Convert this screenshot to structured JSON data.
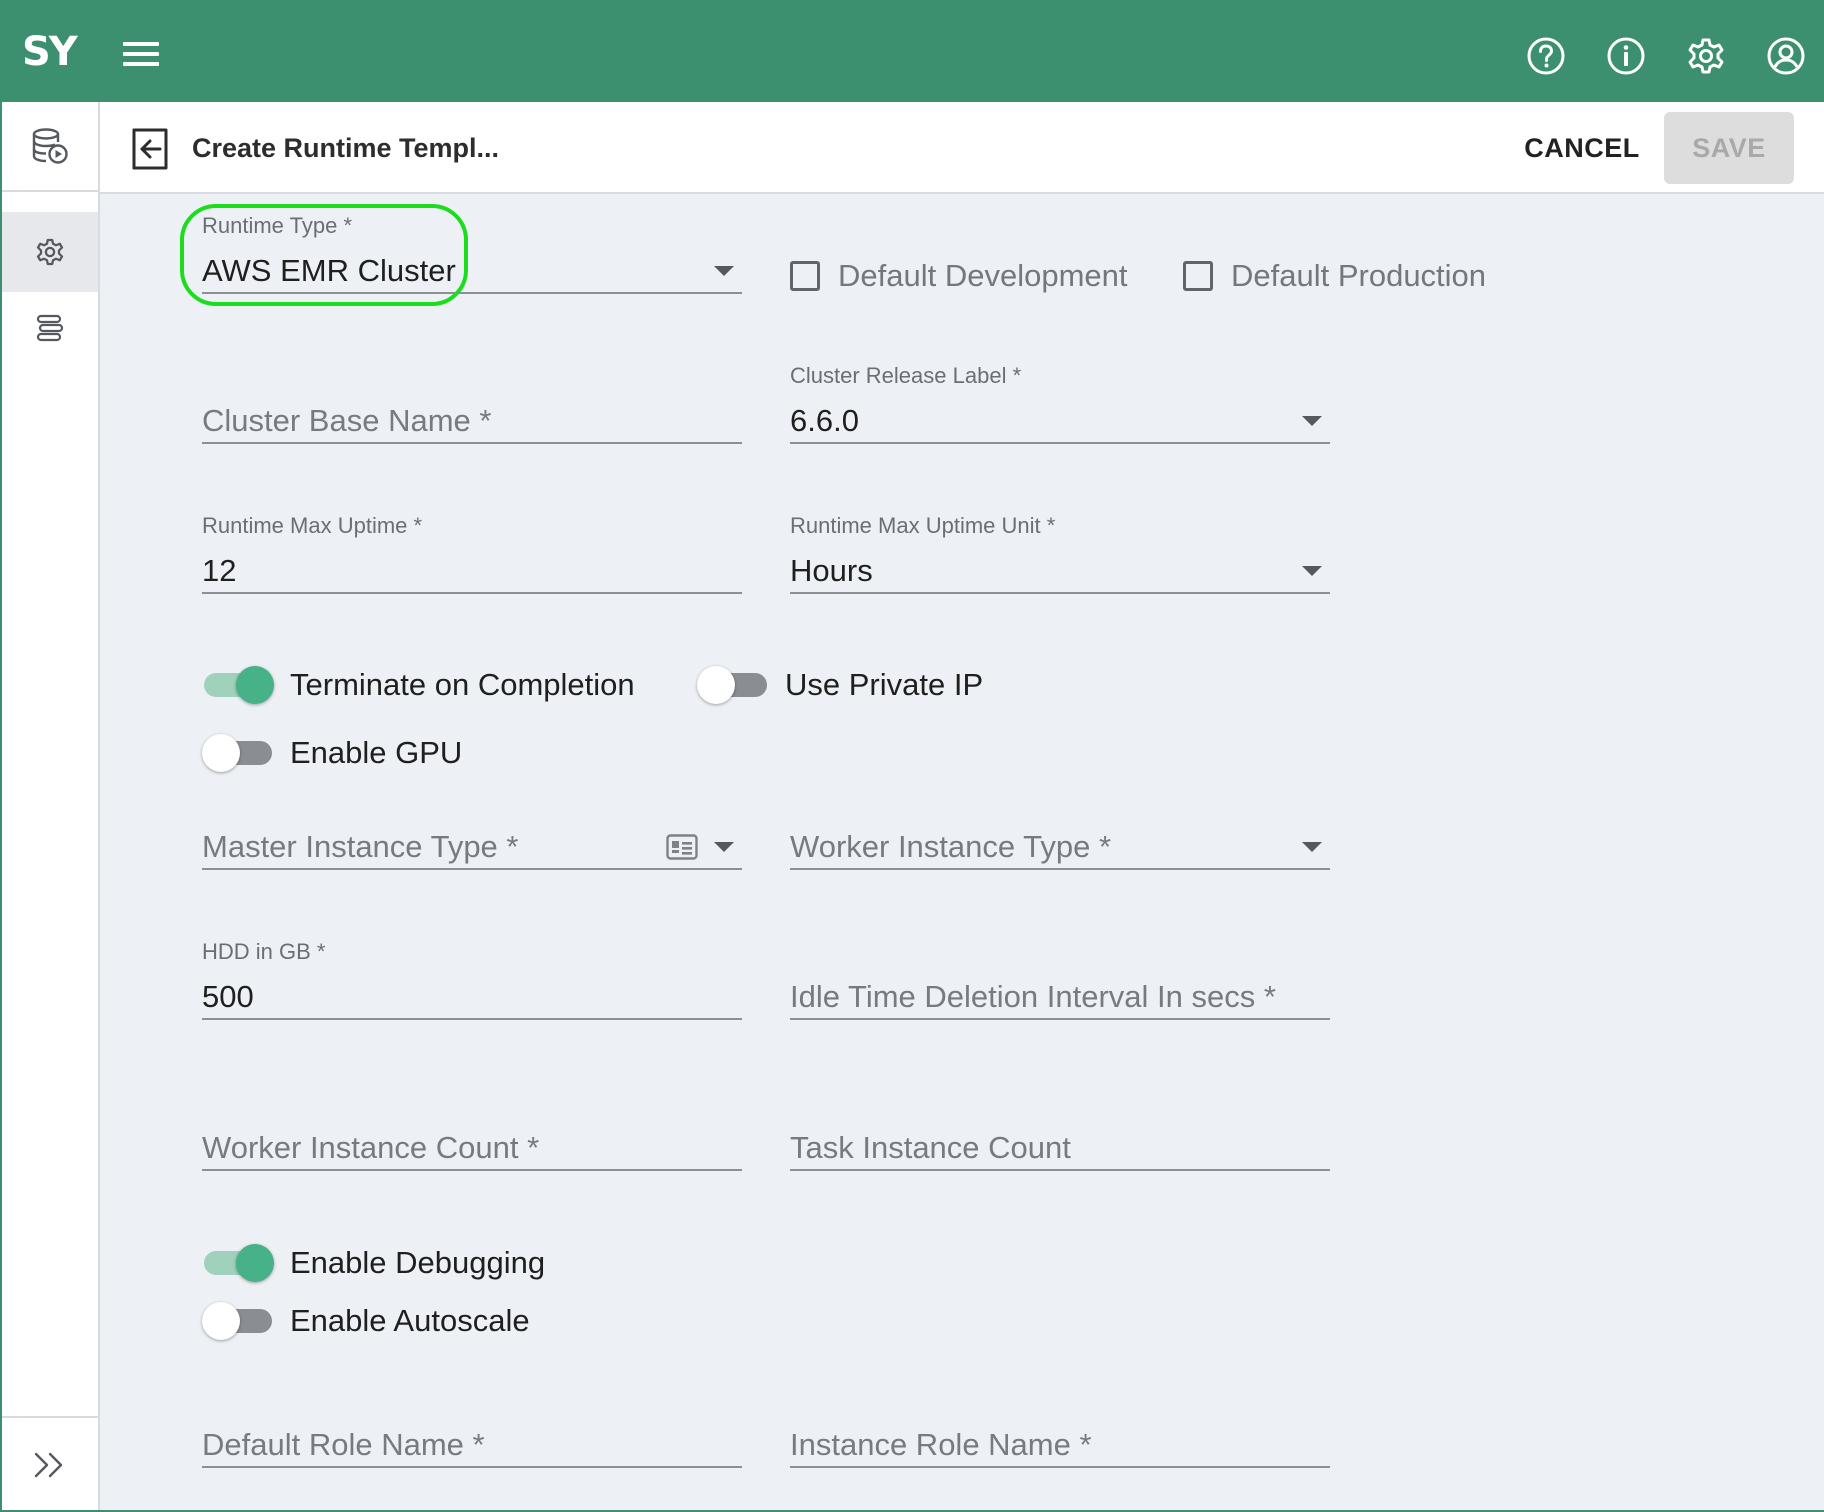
{
  "brand": {
    "logo_text": "SY",
    "primary_color": "#3c9070",
    "accent_color": "#47b188",
    "highlight_color": "#1cdd1c"
  },
  "topbar": {
    "icons": [
      "menu-icon",
      "help-icon",
      "info-icon",
      "settings-icon",
      "account-icon"
    ]
  },
  "sidebar": {
    "icons": [
      "database-play-icon",
      "gear-icon",
      "stack-icon",
      "expand-icon"
    ],
    "active_item": "gear-icon"
  },
  "header": {
    "title": "Create Runtime Templ...",
    "cancel_label": "CANCEL",
    "save_label": "SAVE"
  },
  "form": {
    "runtime_type": {
      "label": "Runtime Type *",
      "value": "AWS EMR Cluster"
    },
    "default_development": {
      "label": "Default Development",
      "checked": false
    },
    "default_production": {
      "label": "Default Production",
      "checked": false
    },
    "cluster_base_name": {
      "placeholder": "Cluster Base Name *"
    },
    "cluster_release_label": {
      "label": "Cluster Release Label *",
      "value": "6.6.0"
    },
    "runtime_max_uptime": {
      "label": "Runtime Max Uptime *",
      "value": "12"
    },
    "runtime_max_uptime_unit": {
      "label": "Runtime Max Uptime Unit *",
      "value": "Hours"
    },
    "terminate_on_completion": {
      "label": "Terminate on Completion",
      "on": true
    },
    "use_private_ip": {
      "label": "Use Private IP",
      "on": false
    },
    "enable_gpu": {
      "label": "Enable GPU",
      "on": false
    },
    "master_instance_type": {
      "placeholder": "Master Instance Type *"
    },
    "worker_instance_type": {
      "placeholder": "Worker Instance Type *"
    },
    "hdd_in_gb": {
      "label": "HDD in GB *",
      "value": "500"
    },
    "idle_time_deletion_interval": {
      "placeholder": "Idle Time Deletion Interval In secs *"
    },
    "worker_instance_count": {
      "placeholder": "Worker Instance Count *"
    },
    "task_instance_count": {
      "placeholder": "Task Instance Count"
    },
    "enable_debugging": {
      "label": "Enable Debugging",
      "on": true
    },
    "enable_autoscale": {
      "label": "Enable Autoscale",
      "on": false
    },
    "default_role_name": {
      "placeholder": "Default Role Name *"
    },
    "instance_role_name": {
      "placeholder": "Instance Role Name *"
    }
  }
}
